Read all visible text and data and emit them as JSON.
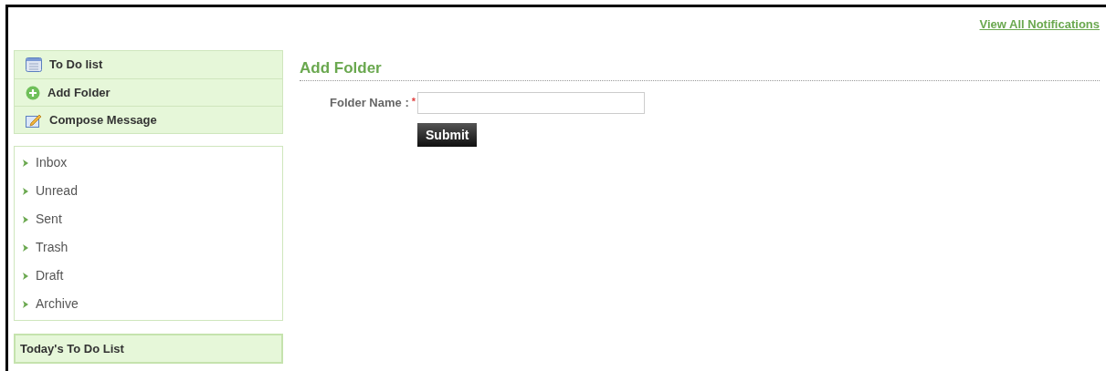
{
  "header": {
    "notifications_link": "View All Notifications"
  },
  "actions": [
    {
      "kind": "todo",
      "label": "To Do list"
    },
    {
      "kind": "add",
      "label": "Add Folder"
    },
    {
      "kind": "compose",
      "label": "Compose Message"
    }
  ],
  "folders": [
    "Inbox",
    "Unread",
    "Sent",
    "Trash",
    "Draft",
    "Archive"
  ],
  "todays_todo": {
    "title": "Today's To Do List"
  },
  "form": {
    "title": "Add Folder",
    "field_label": "Folder Name :",
    "required_mark": "*",
    "submit": "Submit"
  }
}
